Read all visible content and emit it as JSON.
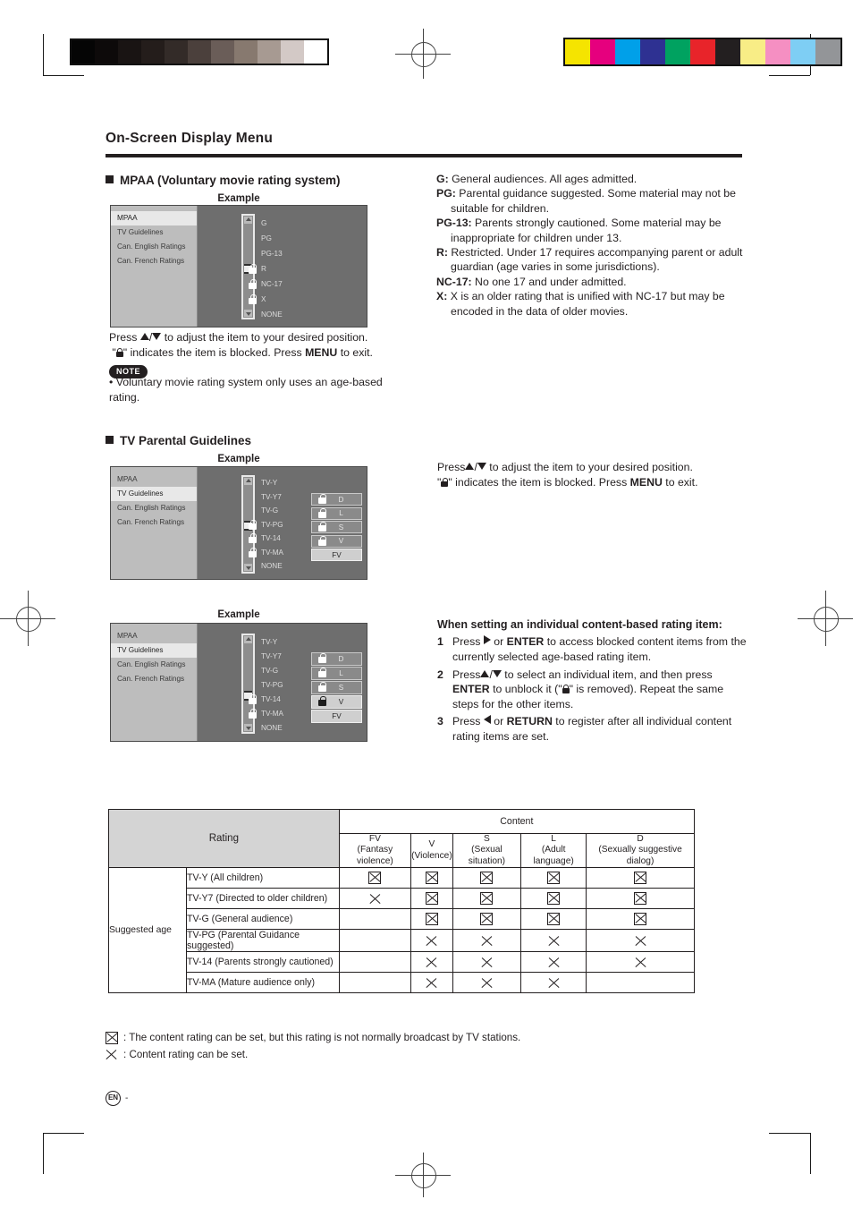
{
  "page": {
    "title": "On-Screen Display Menu",
    "footer_locale": "EN",
    "footer_dash": "-"
  },
  "mpaa_section": {
    "heading": "MPAA (Voluntary movie rating system)",
    "example_label": "Example",
    "osd": {
      "menu_items": [
        "MPAA",
        "TV Guidelines",
        "Can. English Ratings",
        "Can. French Ratings"
      ],
      "selected_menu_item": "MPAA",
      "ratings": [
        {
          "label": "G",
          "locked": false
        },
        {
          "label": "PG",
          "locked": false
        },
        {
          "label": "PG-13",
          "locked": false
        },
        {
          "label": "R",
          "locked": true
        },
        {
          "label": "NC-17",
          "locked": true
        },
        {
          "label": "X",
          "locked": true
        },
        {
          "label": "NONE",
          "locked": false
        }
      ]
    },
    "instruction_line1_a": "Press ",
    "instruction_line1_b": " to adjust the item to your desired position.",
    "instruction_line2_a": "\"",
    "instruction_line2_b": "\" indicates the item is blocked. Press ",
    "instruction_menu": "MENU",
    "instruction_line2_c": " to exit.",
    "note_badge": "NOTE",
    "note_text": "Voluntary movie rating system only uses an age-based rating."
  },
  "mpaa_definitions": [
    {
      "term": "G:",
      "desc": " General audiences. All ages admitted."
    },
    {
      "term": "PG:",
      "desc": " Parental guidance suggested. Some material may not be suitable for children."
    },
    {
      "term": "PG-13:",
      "desc": " Parents strongly cautioned. Some material may be inappropriate for children under 13."
    },
    {
      "term": "R:",
      "desc": " Restricted. Under 17 requires accompanying parent or adult guardian (age varies in some jurisdictions)."
    },
    {
      "term": "NC-17:",
      "desc": " No one 17 and under admitted."
    },
    {
      "term": "X:",
      "desc": " X is an older rating that is unified with NC-17 but may be encoded in the data of older movies."
    }
  ],
  "tv_section": {
    "heading": "TV Parental Guidelines",
    "example_label_1": "Example",
    "example_label_2": "Example",
    "menu_items": [
      "MPAA",
      "TV Guidelines",
      "Can. English Ratings",
      "Can. French Ratings"
    ],
    "selected_menu_item": "TV Guidelines",
    "example1": {
      "ratings": [
        {
          "label": "TV-Y",
          "locked": false
        },
        {
          "label": "TV-Y7",
          "locked": false
        },
        {
          "label": "TV-G",
          "locked": false
        },
        {
          "label": "TV-PG",
          "locked": true
        },
        {
          "label": "TV-14",
          "locked": true
        },
        {
          "label": "TV-MA",
          "locked": true
        },
        {
          "label": "NONE",
          "locked": false
        }
      ],
      "content_boxes": [
        {
          "label": "D",
          "locked": true,
          "highlighted": false
        },
        {
          "label": "L",
          "locked": true,
          "highlighted": false
        },
        {
          "label": "S",
          "locked": true,
          "highlighted": false
        },
        {
          "label": "V",
          "locked": true,
          "highlighted": false
        },
        {
          "label": "FV",
          "locked": false,
          "highlighted": true
        }
      ]
    },
    "example2": {
      "ratings": [
        {
          "label": "TV-Y",
          "locked": false
        },
        {
          "label": "TV-Y7",
          "locked": false
        },
        {
          "label": "TV-G",
          "locked": false
        },
        {
          "label": "TV-PG",
          "locked": false
        },
        {
          "label": "TV-14",
          "locked": true
        },
        {
          "label": "TV-MA",
          "locked": true
        },
        {
          "label": "NONE",
          "locked": false
        }
      ],
      "content_boxes": [
        {
          "label": "D",
          "locked": true,
          "highlighted": false
        },
        {
          "label": "L",
          "locked": true,
          "highlighted": false
        },
        {
          "label": "S",
          "locked": true,
          "highlighted": false
        },
        {
          "label": "V",
          "locked": true,
          "highlighted": true
        },
        {
          "label": "FV",
          "locked": false,
          "highlighted": true
        }
      ]
    },
    "instruction_line1_a": "Press",
    "instruction_line1_b": " to adjust the item to your desired position.",
    "instruction_line2_a": "\"",
    "instruction_line2_b": "\" indicates the item is blocked. Press ",
    "instruction_menu": "MENU",
    "instruction_line2_c": " to exit."
  },
  "individual_setting": {
    "heading": "When setting an individual content-based rating item:",
    "steps": [
      {
        "number": "1",
        "pre": "Press ",
        "key": "ENTER",
        "or": " or ",
        "post": " to access blocked content items from the currently selected age-based rating item."
      },
      {
        "number": "2",
        "pre": "Press",
        "key": "ENTER",
        "mid_a": " to select an individual item, and then press ",
        "mid_b": " to unblock it (\"",
        "mid_c": "\" is removed). Repeat the same steps for the other items."
      },
      {
        "number": "3",
        "pre": "Press ",
        "key": "RETURN",
        "or": " or ",
        "post": " to register after all individual content rating items are set."
      }
    ]
  },
  "rating_table": {
    "rating_header": "Rating",
    "content_header": "Content",
    "age_header": "Suggested age",
    "columns": [
      {
        "code": "FV",
        "desc": "(Fantasy violence)"
      },
      {
        "code": "V",
        "desc": "(Violence)"
      },
      {
        "code": "S",
        "desc": "(Sexual situation)"
      },
      {
        "code": "L",
        "desc": "(Adult language)"
      },
      {
        "code": "D",
        "desc": "(Sexually suggestive dialog)"
      }
    ],
    "rows": [
      {
        "rating": "TV-Y (All children)",
        "marks": [
          "boxx",
          "boxx",
          "boxx",
          "boxx",
          "boxx"
        ]
      },
      {
        "rating": "TV-Y7 (Directed to older children)",
        "marks": [
          "exx",
          "boxx",
          "boxx",
          "boxx",
          "boxx"
        ]
      },
      {
        "rating": "TV-G (General audience)",
        "marks": [
          "",
          "boxx",
          "boxx",
          "boxx",
          "boxx"
        ]
      },
      {
        "rating": "TV-PG (Parental Guidance suggested)",
        "marks": [
          "",
          "exx",
          "exx",
          "exx",
          "exx"
        ]
      },
      {
        "rating": "TV-14 (Parents strongly cautioned)",
        "marks": [
          "",
          "exx",
          "exx",
          "exx",
          "exx"
        ]
      },
      {
        "rating": "TV-MA (Mature audience only)",
        "marks": [
          "",
          "exx",
          "exx",
          "exx",
          ""
        ]
      }
    ]
  },
  "table_legend": [
    {
      "mark": "boxx",
      "text": ": The content rating can be set, but this rating is not normally broadcast by TV stations."
    },
    {
      "mark": "exx",
      "text": ": Content rating can be set."
    }
  ],
  "print_marks": {
    "gray_steps": [
      "#050505",
      "#0d0a0a",
      "#191413",
      "#241d1b",
      "#332b28",
      "#4b403c",
      "#6a5d58",
      "#87796f",
      "#a79a92",
      "#d3c9c6",
      "#ffffff"
    ],
    "color_steps": [
      "#f5e400",
      "#e6007e",
      "#00a0e9",
      "#2e3192",
      "#00a260",
      "#e8242a",
      "#231f20",
      "#f8ed86",
      "#f58fc2",
      "#7ecef4",
      "#939598"
    ]
  }
}
